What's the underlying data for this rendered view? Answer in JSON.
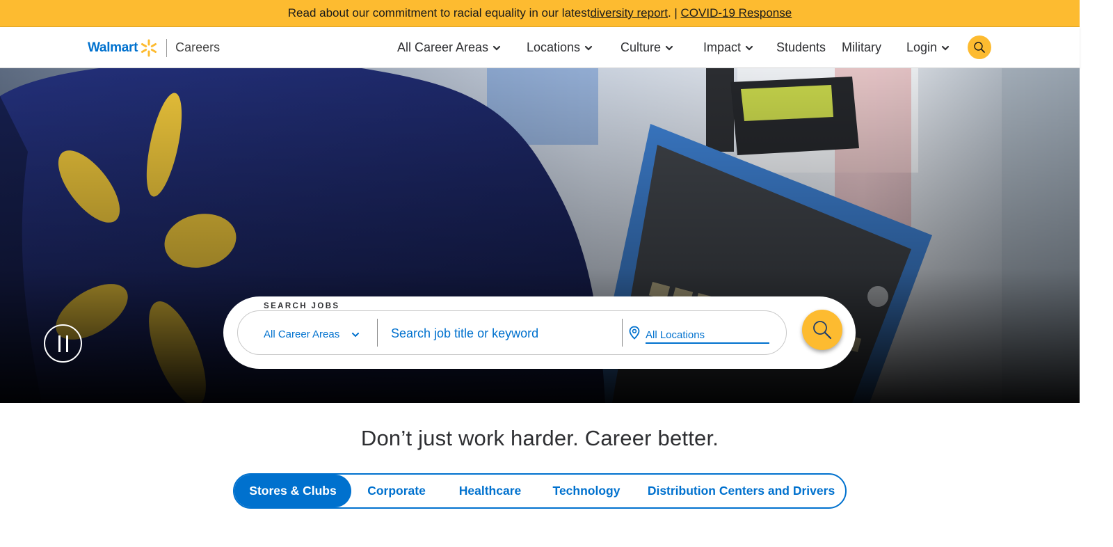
{
  "announcement": {
    "prefix": "Read about our commitment to racial equality in our latest ",
    "diversity_link": "diversity report",
    "middle": ". | ",
    "covid_link": "COVID-19 Response"
  },
  "header": {
    "brand": "Walmart",
    "section": "Careers",
    "nav": [
      {
        "label": "All Career Areas",
        "dropdown": true
      },
      {
        "label": "Locations",
        "dropdown": true
      },
      {
        "label": "Culture",
        "dropdown": true
      },
      {
        "label": "Impact",
        "dropdown": true
      },
      {
        "label": "Students",
        "dropdown": false
      },
      {
        "label": "Military",
        "dropdown": false
      },
      {
        "label": "Login",
        "dropdown": true
      }
    ],
    "search_icon": "search-icon"
  },
  "hero": {
    "search": {
      "legend": "SEARCH JOBS",
      "career_area": "All Career Areas",
      "keyword_placeholder": "Search job title or keyword",
      "location_placeholder": "All Locations"
    },
    "pause_icon": "pause-icon"
  },
  "tagline": "Don’t just work harder. Career better.",
  "tabs": [
    {
      "label": "Stores & Clubs",
      "active": true
    },
    {
      "label": "Corporate",
      "active": false
    },
    {
      "label": "Healthcare",
      "active": false
    },
    {
      "label": "Technology",
      "active": false
    },
    {
      "label": "Distribution Centers and Drivers",
      "active": false
    }
  ],
  "colors": {
    "brand_blue": "#0071ce",
    "spark_yellow": "#fdbb30",
    "text_dark": "#2e2f32"
  }
}
